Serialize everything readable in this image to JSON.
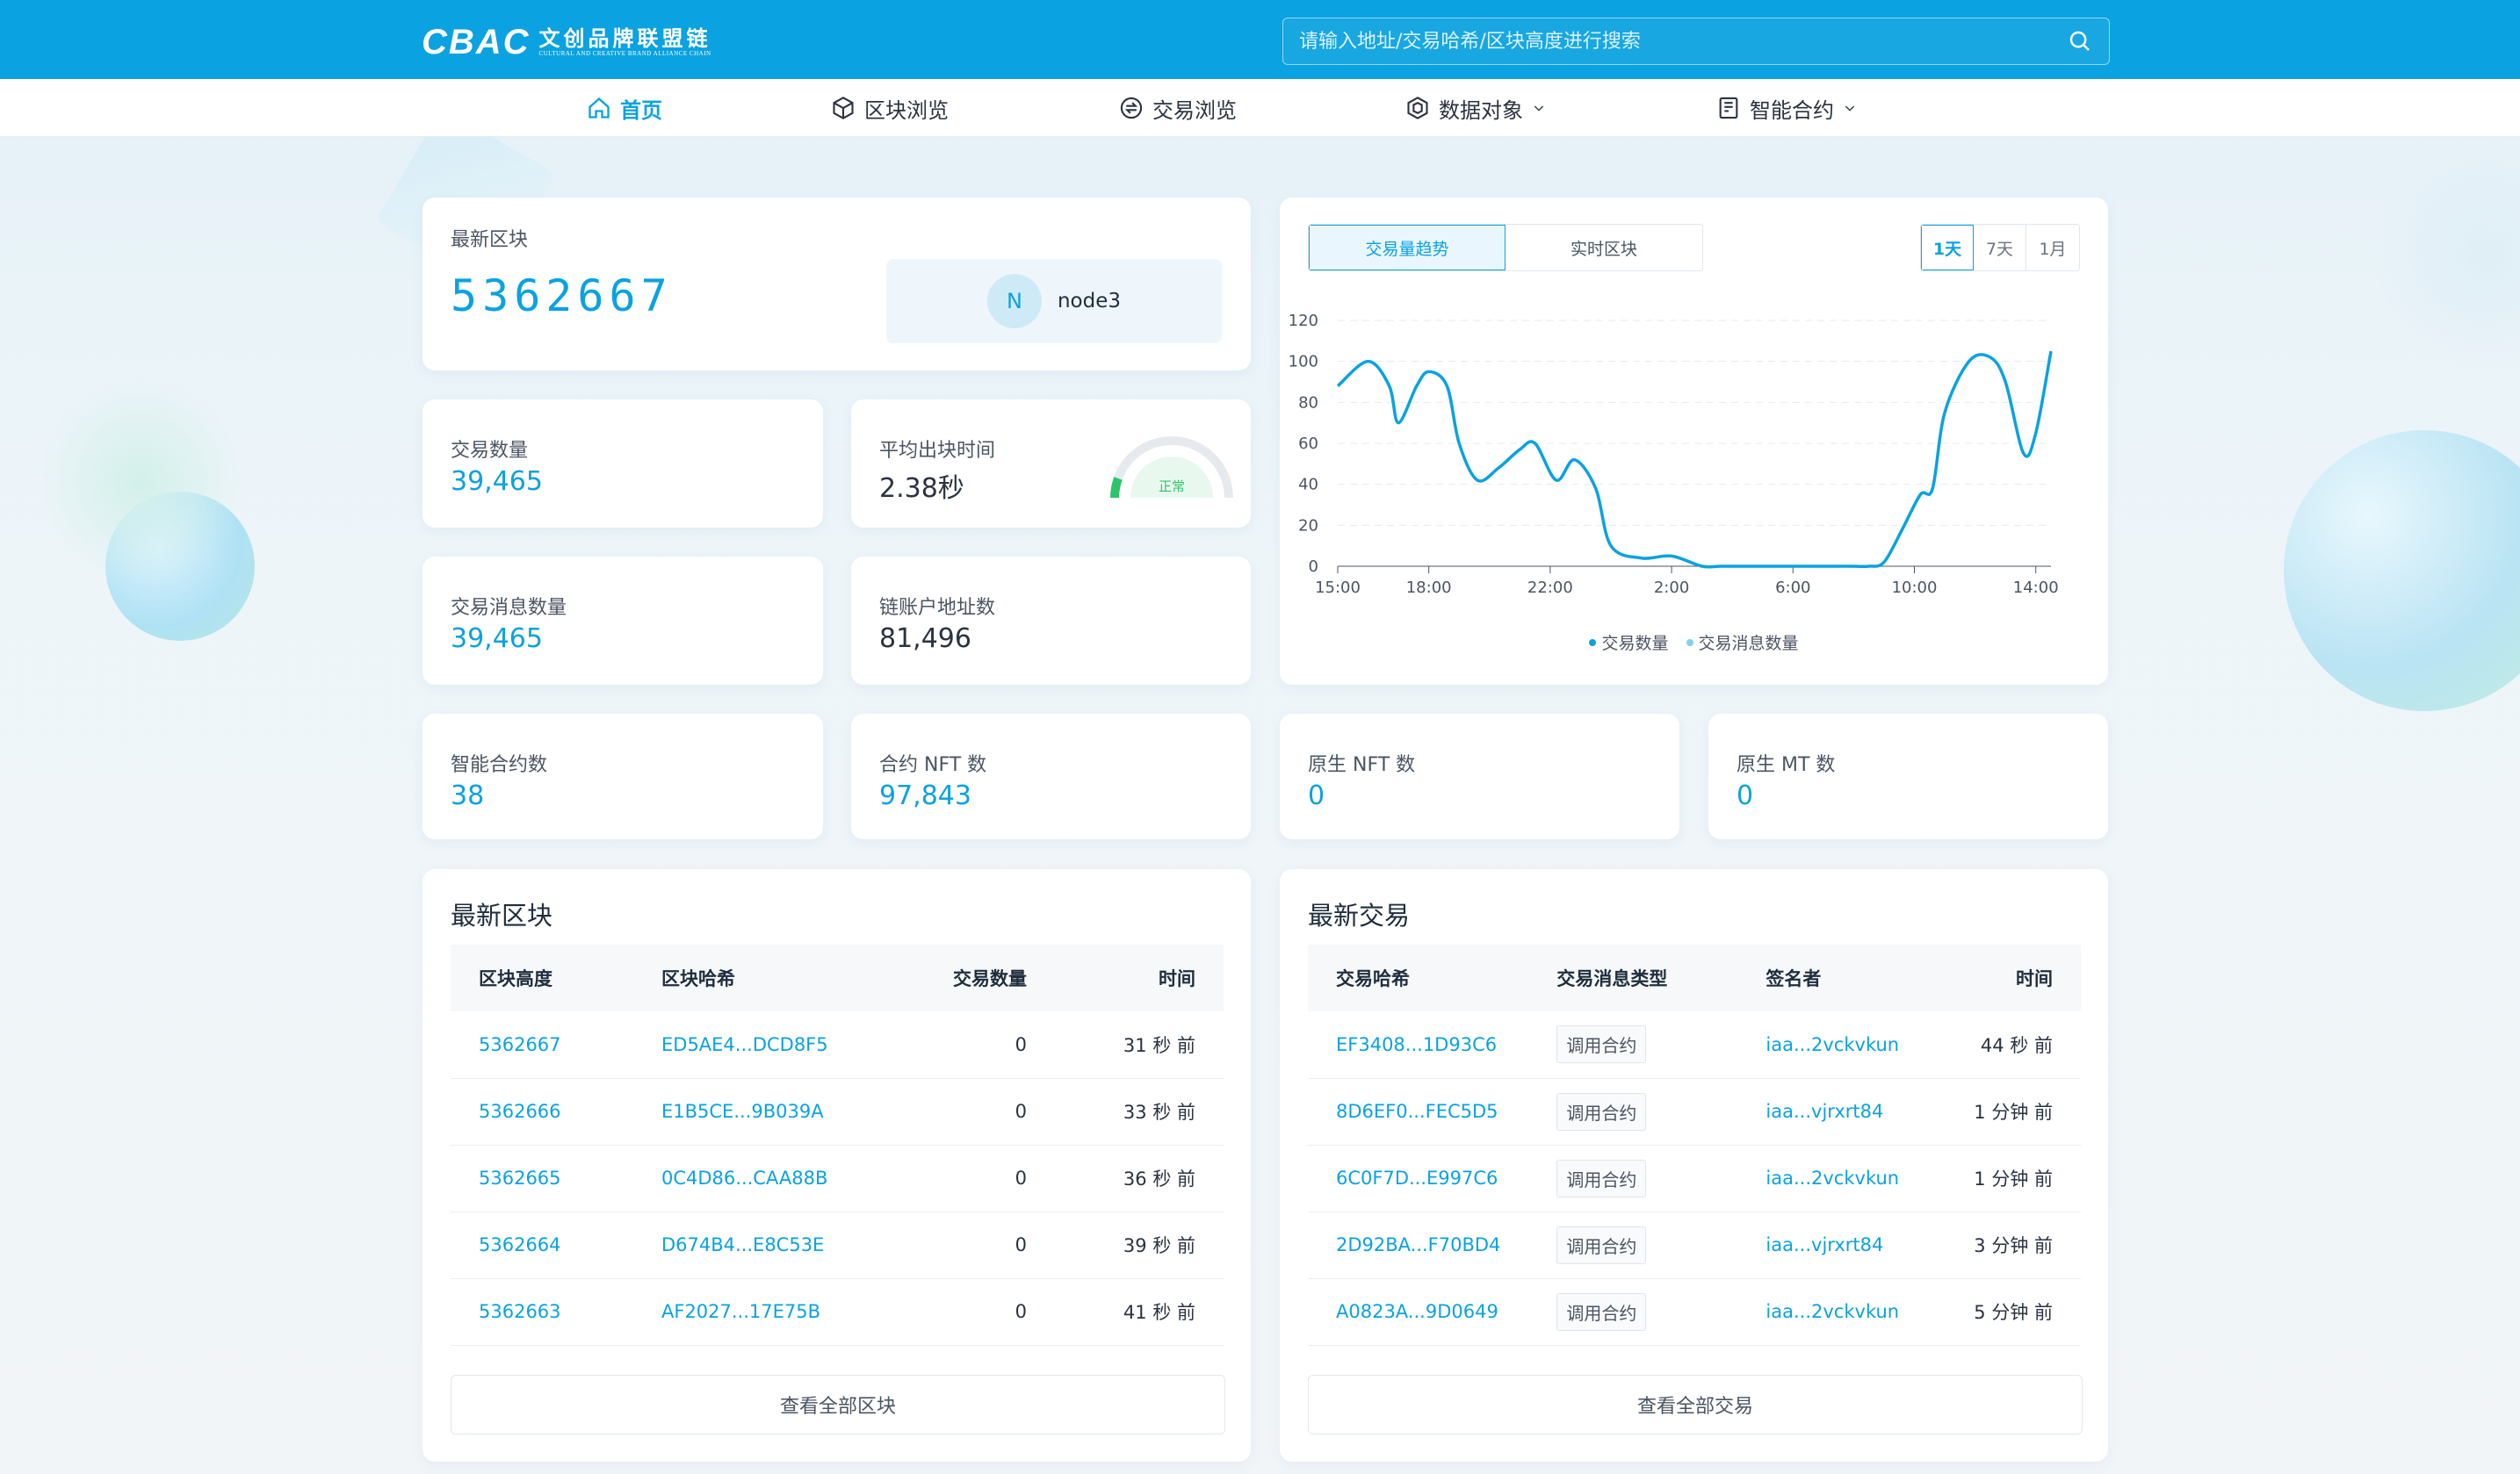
{
  "header": {
    "logo_mark": "CBAC",
    "logo_cn": "文创品牌联盟链",
    "logo_en": "CULTURAL AND CREATIVE BRAND ALLIANCE CHAIN",
    "search_placeholder": "请输入地址/交易哈希/区块高度进行搜索"
  },
  "nav": [
    {
      "label": "首页",
      "icon": "home-icon",
      "active": true
    },
    {
      "label": "区块浏览",
      "icon": "cube-icon"
    },
    {
      "label": "交易浏览",
      "icon": "exchange-icon"
    },
    {
      "label": "数据对象",
      "icon": "data-object-icon"
    },
    {
      "label": "智能合约",
      "icon": "contract-icon"
    }
  ],
  "latest_block": {
    "label": "最新区块",
    "value": "5362667",
    "node_initial": "N",
    "node_name": "node3"
  },
  "stats": {
    "tx_count": {
      "label": "交易数量",
      "value": "39,465"
    },
    "avg_block_time": {
      "label": "平均出块时间",
      "value": "2.38秒",
      "gauge_status": "正常"
    },
    "tx_msg_count": {
      "label": "交易消息数量",
      "value": "39,465"
    },
    "account_count": {
      "label": "链账户地址数",
      "value": "81,496"
    },
    "contract_count": {
      "label": "智能合约数",
      "value": "38"
    },
    "contract_nft_count": {
      "label": "合约 NFT 数",
      "value": "97,843"
    },
    "native_nft_count": {
      "label": "原生 NFT 数",
      "value": "0"
    },
    "native_mt_count": {
      "label": "原生 MT 数",
      "value": "0"
    }
  },
  "chart_panel": {
    "tabs": [
      "交易量趋势",
      "实时区块"
    ],
    "ranges": [
      "1天",
      "7天",
      "1月"
    ],
    "legend": [
      "交易数量",
      "交易消息数量"
    ]
  },
  "chart_data": {
    "type": "line",
    "x_ticks": [
      "15:00",
      "18:00",
      "22:00",
      "2:00",
      "6:00",
      "10:00",
      "14:00"
    ],
    "y_ticks": [
      0,
      20,
      40,
      60,
      80,
      100,
      120
    ],
    "ylim": [
      0,
      120
    ],
    "series": [
      {
        "name": "交易数量",
        "color": "#0aa2e0",
        "x_hours": [
          0,
          1,
          1.7,
          2,
          2.6,
          3,
          3.6,
          4,
          4.6,
          5.3,
          6,
          6.5,
          7.2,
          7.8,
          8.5,
          9,
          10,
          11,
          12,
          12.6,
          13,
          14,
          15.2,
          16,
          17,
          17.5,
          18,
          18.6,
          19.2,
          19.6,
          20,
          20.8,
          21.5,
          22,
          22.6,
          23,
          23.5
        ],
        "values": [
          88,
          100,
          88,
          70,
          88,
          95,
          88,
          60,
          42,
          48,
          57,
          60,
          42,
          52,
          38,
          10,
          4,
          5,
          0,
          0,
          0,
          0,
          0,
          0,
          0,
          0,
          2,
          18,
          35,
          38,
          75,
          100,
          102,
          90,
          55,
          65,
          105
        ]
      },
      {
        "name": "交易消息数量",
        "color": "#7fd3f0",
        "values": []
      }
    ]
  },
  "blocks_table": {
    "title": "最新区块",
    "headers": [
      "区块高度",
      "区块哈希",
      "交易数量",
      "时间"
    ],
    "rows": [
      {
        "height": "5362667",
        "hash": "ED5AE4...DCD8F5",
        "tx": "0",
        "time": "31 秒 前"
      },
      {
        "height": "5362666",
        "hash": "E1B5CE...9B039A",
        "tx": "0",
        "time": "33 秒 前"
      },
      {
        "height": "5362665",
        "hash": "0C4D86...CAA88B",
        "tx": "0",
        "time": "36 秒 前"
      },
      {
        "height": "5362664",
        "hash": "D674B4...E8C53E",
        "tx": "0",
        "time": "39 秒 前"
      },
      {
        "height": "5362663",
        "hash": "AF2027...17E75B",
        "tx": "0",
        "time": "41 秒 前"
      }
    ],
    "view_all": "查看全部区块"
  },
  "tx_table": {
    "title": "最新交易",
    "headers": [
      "交易哈希",
      "交易消息类型",
      "签名者",
      "时间"
    ],
    "rows": [
      {
        "hash": "EF3408...1D93C6",
        "type": "调用合约",
        "signer": "iaa...2vckvkun",
        "time": "44 秒 前"
      },
      {
        "hash": "8D6EF0...FEC5D5",
        "type": "调用合约",
        "signer": "iaa...vjrxrt84",
        "time": "1 分钟 前"
      },
      {
        "hash": "6C0F7D...E997C6",
        "type": "调用合约",
        "signer": "iaa...2vckvkun",
        "time": "1 分钟 前"
      },
      {
        "hash": "2D92BA...F70BD4",
        "type": "调用合约",
        "signer": "iaa...vjrxrt84",
        "time": "3 分钟 前"
      },
      {
        "hash": "A0823A...9D0649",
        "type": "调用合约",
        "signer": "iaa...2vckvkun",
        "time": "5 分钟 前"
      }
    ],
    "view_all": "查看全部交易"
  }
}
